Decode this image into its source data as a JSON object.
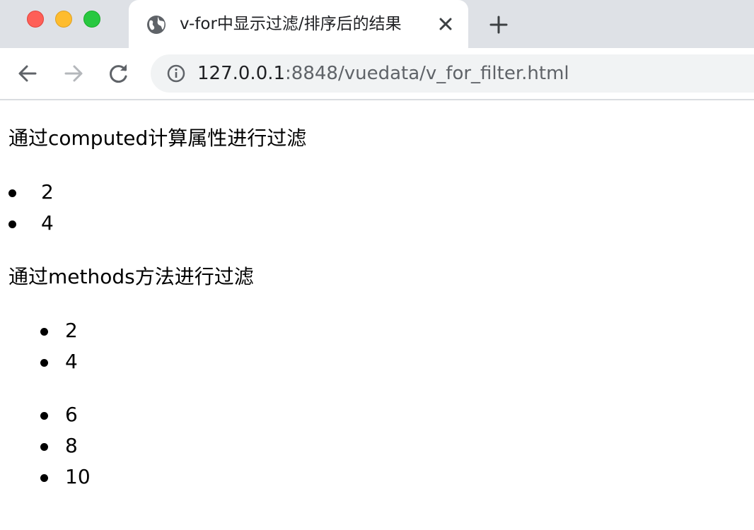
{
  "browser": {
    "tab": {
      "title": "v-for中显示过滤/排序后的结果",
      "icon": "globe-icon",
      "close_icon": "close-icon"
    },
    "new_tab_icon": "plus-icon",
    "nav": {
      "back_icon": "arrow-left-icon",
      "forward_icon": "arrow-right-icon",
      "reload_icon": "reload-icon"
    },
    "address": {
      "info_icon": "info-icon",
      "host": "127.0.0.1",
      "path": ":8848/vuedata/v_for_filter.html"
    }
  },
  "page": {
    "heading_computed": "通过computed计算属性进行过滤",
    "computed_items": [
      "2",
      "4"
    ],
    "heading_methods": "通过methods方法进行过滤",
    "methods_list_1": [
      "2",
      "4"
    ],
    "methods_list_2": [
      "6",
      "8",
      "10"
    ]
  }
}
